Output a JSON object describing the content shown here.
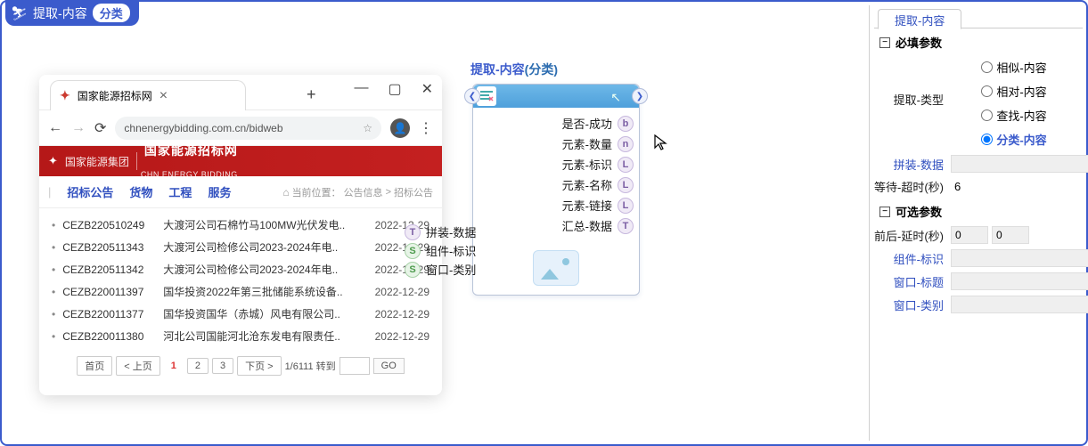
{
  "header": {
    "title": "提取-内容",
    "pill": "分类"
  },
  "browser": {
    "tab_title": "国家能源招标网",
    "url": "chnenergybidding.com.cn/bidweb"
  },
  "site": {
    "group": "国家能源集团",
    "name_cn": "国家能源招标网",
    "name_en": "CHN ENERGY BIDDING",
    "nav": [
      "招标公告",
      "货物",
      "工程",
      "服务"
    ],
    "crumb_label": "当前位置：",
    "crumb1": "公告信息",
    "crumb2": "招标公告"
  },
  "rows": [
    {
      "code": "CEZB220510249",
      "title": "大渡河公司石棉竹马100MW光伏发电..",
      "date": "2022-12-29"
    },
    {
      "code": "CEZB220511343",
      "title": "大渡河公司检修公司2023-2024年电..",
      "date": "2022-12-29"
    },
    {
      "code": "CEZB220511342",
      "title": "大渡河公司检修公司2023-2024年电..",
      "date": "2022-12-29"
    },
    {
      "code": "CEZB220011397",
      "title": "国华投资2022年第三批储能系统设备..",
      "date": "2022-12-29"
    },
    {
      "code": "CEZB220011377",
      "title": "国华投资国华（赤城）风电有限公司..",
      "date": "2022-12-29"
    },
    {
      "code": "CEZB220011380",
      "title": "河北公司国能河北沧东发电有限责任..",
      "date": "2022-12-29"
    }
  ],
  "pager": {
    "first": "首页",
    "prev": "< 上页",
    "next": "下页 >",
    "cur": "1",
    "p2": "2",
    "p3": "3",
    "info": "1/6111 转到",
    "go": "GO"
  },
  "node": {
    "title": "提取-内容",
    "subtitle": "(分类)",
    "outputs": [
      {
        "label": "是否-成功",
        "t": "b"
      },
      {
        "label": "元素-数量",
        "t": "n"
      },
      {
        "label": "元素-标识",
        "t": "L"
      },
      {
        "label": "元素-名称",
        "t": "L"
      },
      {
        "label": "元素-链接",
        "t": "L"
      },
      {
        "label": "汇总-数据",
        "t": "T"
      }
    ],
    "inputs": [
      {
        "label": "拼装-数据",
        "t": "T"
      },
      {
        "label": "组件-标识",
        "t": "S"
      },
      {
        "label": "窗口-类别",
        "t": "S"
      }
    ]
  },
  "panel": {
    "tab": "提取-内容",
    "required_hdr": "必填参数",
    "type_label": "提取-类型",
    "type_opts": [
      "相似-内容",
      "相对-内容",
      "查找-内容",
      "分类-内容"
    ],
    "type_selected": 3,
    "assemble_label": "拼装-数据",
    "wait_label": "等待-超时(秒)",
    "wait_value": "6",
    "optional_hdr": "可选参数",
    "delay_label": "前后-延时(秒)",
    "delay_v1": "0",
    "delay_v2": "0",
    "comp_label": "组件-标识",
    "wintitle_label": "窗口-标题",
    "wintype_label": "窗口-类别"
  }
}
